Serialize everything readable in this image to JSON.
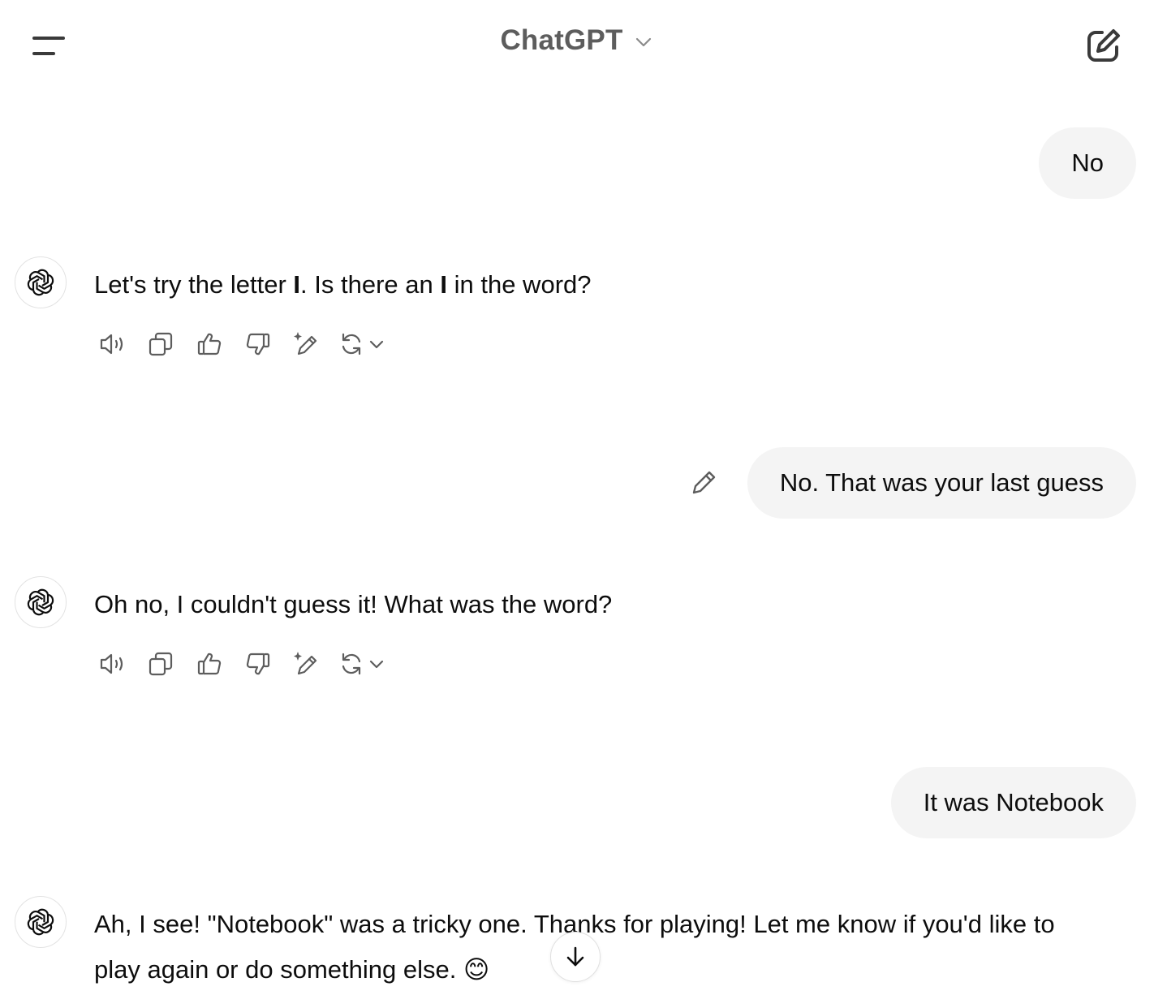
{
  "header": {
    "title": "ChatGPT"
  },
  "messages": [
    {
      "role": "user",
      "text": "No"
    },
    {
      "role": "assistant",
      "parts": [
        "Let's try the letter ",
        "I",
        ". Is there an ",
        "I",
        " in the word?"
      ]
    },
    {
      "role": "user",
      "text": "No. That was your last guess"
    },
    {
      "role": "assistant",
      "text": "Oh no, I couldn't guess it! What was the word?"
    },
    {
      "role": "user",
      "text": "It was Notebook"
    },
    {
      "role": "assistant",
      "line1": "Ah, I see! \"Notebook\" was a tricky one. Thanks for playing! Let me know if you'd like to",
      "line2": "play again or do something else. ",
      "emoji": "😊"
    }
  ],
  "icons": {
    "menu": "menu-icon",
    "title_dropdown": "chevron-down-icon",
    "new_chat": "edit-icon",
    "avatar": "openai-logo-icon",
    "read_aloud": "speaker-icon",
    "copy": "copy-icon",
    "thumbs_up": "thumbs-up-icon",
    "thumbs_down": "thumbs-down-icon",
    "edit_canvas": "pencil-sparkle-icon",
    "regenerate": "refresh-icon",
    "edit_message": "pencil-icon",
    "scroll_down": "arrow-down-icon"
  },
  "colors": {
    "bubble_bg": "#f4f4f4",
    "title": "#5d5d5d",
    "text": "#0d0d0d",
    "icon": "#5d5d5d"
  }
}
